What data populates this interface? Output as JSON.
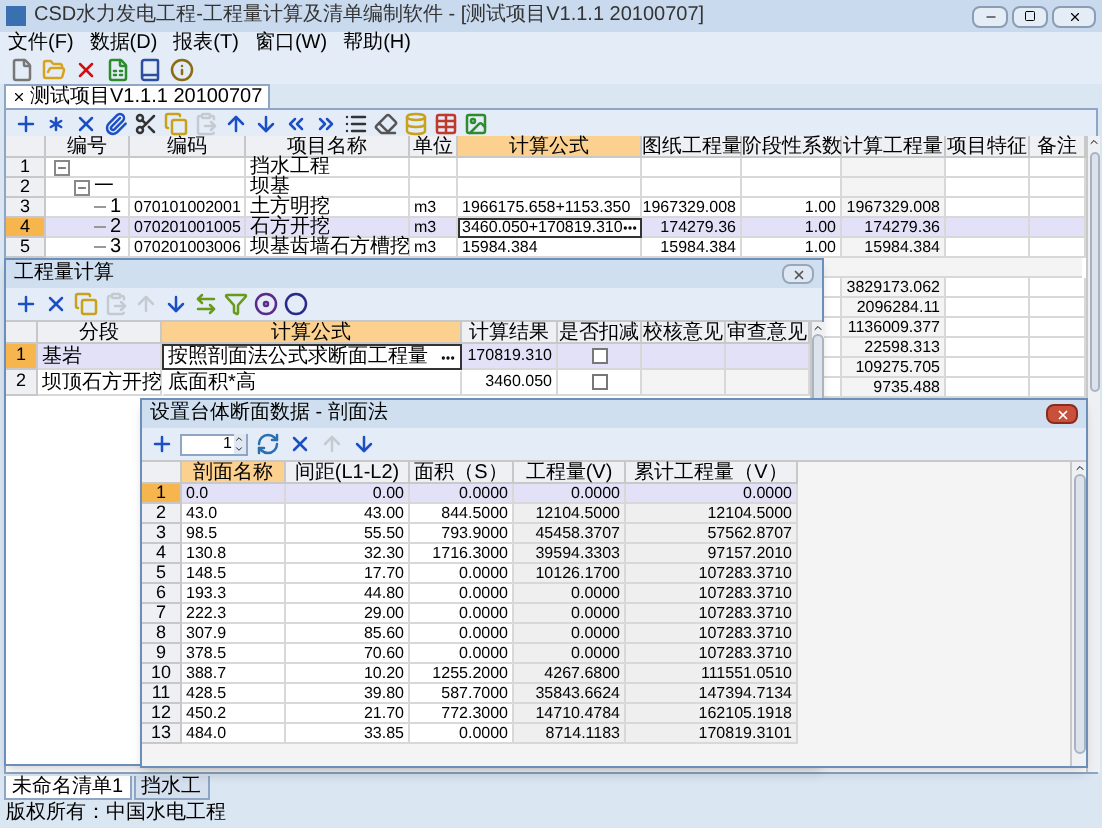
{
  "window": {
    "title": "CSD水力发电工程-工程量计算及清单编制软件 - [测试项目V1.1.1 20100707]"
  },
  "menu": [
    "文件(F)",
    "数据(D)",
    "报表(T)",
    "窗口(W)",
    "帮助(H)"
  ],
  "document_tab": {
    "label": "测试项目V1.1.1 20100707",
    "selected": true
  },
  "main_table": {
    "columns": [
      {
        "label": "编号",
        "selected": false
      },
      {
        "label": "编码",
        "selected": false
      },
      {
        "label": "项目名称",
        "selected": false
      },
      {
        "label": "单位",
        "selected": false
      },
      {
        "label": "计算公式",
        "selected": true
      },
      {
        "label": "图纸工程量",
        "selected": false
      },
      {
        "label": "阶段性系数",
        "selected": false
      },
      {
        "label": "计算工程量",
        "selected": false
      },
      {
        "label": "项目特征",
        "selected": false
      },
      {
        "label": "备注",
        "selected": false
      }
    ],
    "rows": [
      {
        "row_number": "1",
        "name": "挡水工程",
        "selected": false,
        "expanded": true,
        "children": [
          {
            "row_number": "2",
            "number": "一",
            "name": "坝基",
            "selected": false,
            "expanded": true,
            "children": [
              {
                "row_number": "3",
                "number": "1",
                "code": "070101002001",
                "name": "土方明挖",
                "unit": "m3",
                "formula": "1966175.658+1153.350",
                "drawing_qty": "1967329.008",
                "coefficient": "1.00",
                "computed_qty": "1967329.008",
                "selected": false
              },
              {
                "row_number": "4",
                "number": "2",
                "code": "070201001005",
                "name": "石方开挖",
                "unit": "m3",
                "formula": "3460.050+170819.310",
                "drawing_qty": "174279.36",
                "coefficient": "1.00",
                "computed_qty": "174279.36",
                "selected": true
              },
              {
                "row_number": "5",
                "number": "3",
                "code": "070201003006",
                "name": "坝基齿墙石方槽挖",
                "unit": "m3",
                "formula": "15984.384",
                "drawing_qty": "15984.384",
                "coefficient": "1.00",
                "computed_qty": "15984.384",
                "selected": false
              }
            ]
          }
        ]
      }
    ],
    "more_rows": [
      {
        "computed_qty": "3829173.062"
      },
      {
        "computed_qty": "2096284.11"
      },
      {
        "computed_qty": "1136009.377"
      },
      {
        "computed_qty": "22598.313"
      },
      {
        "computed_qty": "109275.705"
      },
      {
        "computed_qty": "9735.488"
      }
    ]
  },
  "calc_dialog": {
    "title": "工程量计算",
    "columns": [
      {
        "label": "分段",
        "selected": false
      },
      {
        "label": "计算公式",
        "selected": true
      },
      {
        "label": "计算结果",
        "selected": false
      },
      {
        "label": "是否扣减",
        "selected": false
      },
      {
        "label": "校核意见",
        "selected": false
      },
      {
        "label": "审查意见",
        "selected": false
      }
    ],
    "rows": [
      {
        "row_number": "1",
        "segment": "基岩",
        "formula": "按照剖面法公式求断面工程量",
        "result": "170819.310",
        "deduct": false,
        "selected": true
      },
      {
        "row_number": "2",
        "segment": "坝顶石方开挖",
        "formula": "底面积*高",
        "result": "3460.050",
        "deduct": false,
        "selected": false
      }
    ]
  },
  "section_dialog": {
    "title": "设置台体断面数据 - 剖面法",
    "spinner_value": "1",
    "columns": [
      {
        "label": "剖面名称",
        "selected": true
      },
      {
        "label": "间距(L1-L2)",
        "selected": false
      },
      {
        "label": "面积（S）",
        "selected": false
      },
      {
        "label": "工程量(V)",
        "selected": false
      },
      {
        "label": "累计工程量（V）",
        "selected": false
      }
    ],
    "rows": [
      {
        "row_number": "1",
        "name": "0.0",
        "spacing": "0.00",
        "area": "0.0000",
        "volume": "0.0000",
        "cumulative": "0.0000",
        "selected": true
      },
      {
        "row_number": "2",
        "name": "43.0",
        "spacing": "43.00",
        "area": "844.5000",
        "volume": "12104.5000",
        "cumulative": "12104.5000",
        "selected": false
      },
      {
        "row_number": "3",
        "name": "98.5",
        "spacing": "55.50",
        "area": "793.9000",
        "volume": "45458.3707",
        "cumulative": "57562.8707",
        "selected": false
      },
      {
        "row_number": "4",
        "name": "130.8",
        "spacing": "32.30",
        "area": "1716.3000",
        "volume": "39594.3303",
        "cumulative": "97157.2010",
        "selected": false
      },
      {
        "row_number": "5",
        "name": "148.5",
        "spacing": "17.70",
        "area": "0.0000",
        "volume": "10126.1700",
        "cumulative": "107283.3710",
        "selected": false
      },
      {
        "row_number": "6",
        "name": "193.3",
        "spacing": "44.80",
        "area": "0.0000",
        "volume": "0.0000",
        "cumulative": "107283.3710",
        "selected": false
      },
      {
        "row_number": "7",
        "name": "222.3",
        "spacing": "29.00",
        "area": "0.0000",
        "volume": "0.0000",
        "cumulative": "107283.3710",
        "selected": false
      },
      {
        "row_number": "8",
        "name": "307.9",
        "spacing": "85.60",
        "area": "0.0000",
        "volume": "0.0000",
        "cumulative": "107283.3710",
        "selected": false
      },
      {
        "row_number": "9",
        "name": "378.5",
        "spacing": "70.60",
        "area": "0.0000",
        "volume": "0.0000",
        "cumulative": "107283.3710",
        "selected": false
      },
      {
        "row_number": "10",
        "name": "388.7",
        "spacing": "10.20",
        "area": "1255.2000",
        "volume": "4267.6800",
        "cumulative": "111551.0510",
        "selected": false
      },
      {
        "row_number": "11",
        "name": "428.5",
        "spacing": "39.80",
        "area": "587.7000",
        "volume": "35843.6624",
        "cumulative": "147394.7134",
        "selected": false
      },
      {
        "row_number": "12",
        "name": "450.2",
        "spacing": "21.70",
        "area": "772.3000",
        "volume": "14710.4784",
        "cumulative": "162105.1918",
        "selected": false
      },
      {
        "row_number": "13",
        "name": "484.0",
        "spacing": "33.85",
        "area": "0.0000",
        "volume": "8714.1183",
        "cumulative": "170819.3101",
        "selected": false
      }
    ]
  },
  "bottom_tabs": [
    {
      "label": "未命名清单1",
      "selected": true
    },
    {
      "label": "挡水工",
      "selected": false
    }
  ],
  "status_bar": {
    "text": "版权所有：中国水电工程"
  }
}
